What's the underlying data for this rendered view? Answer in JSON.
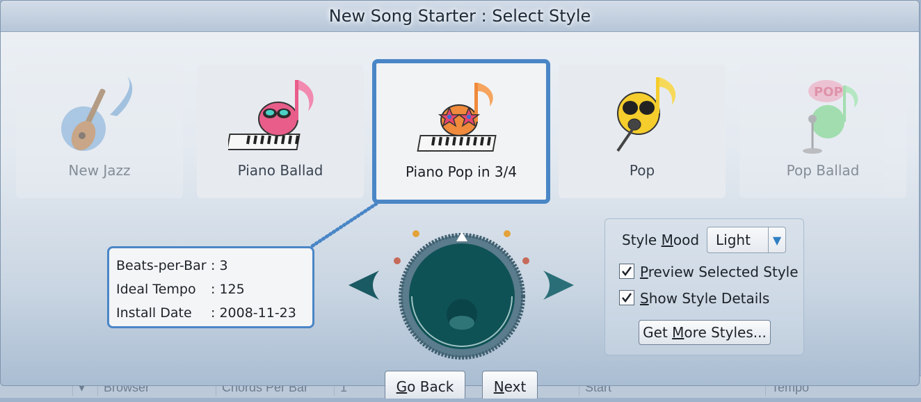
{
  "window": {
    "title": "New Song Starter : Select Style"
  },
  "styles": [
    {
      "label": "New Jazz",
      "icon": "guitar-note-icon"
    },
    {
      "label": "Piano Ballad",
      "icon": "piano-ballad-note-icon"
    },
    {
      "label": "Piano Pop in 3/4",
      "icon": "piano-pop-note-icon"
    },
    {
      "label": "Pop",
      "icon": "pop-mic-note-icon"
    },
    {
      "label": "Pop Ballad",
      "icon": "pop-ballad-note-icon"
    }
  ],
  "selected_style": "Piano Pop in 3/4",
  "details": {
    "beats_label": "Beats-per-Bar",
    "beats_value": ": 3",
    "tempo_label": "Ideal Tempo",
    "tempo_value": ": 125",
    "date_label": "Install Date",
    "date_value": ": 2008-11-23"
  },
  "options": {
    "mood_label_pre": "Style ",
    "mood_label_u": "M",
    "mood_label_post": "ood",
    "mood_value": "Light",
    "preview_u": "P",
    "preview_rest": "review Selected Style",
    "preview_checked": true,
    "details_u": "S",
    "details_rest": "how Style Details",
    "details_checked": true,
    "more_pre": "Get ",
    "more_u": "M",
    "more_post": "ore Styles..."
  },
  "nav": {
    "back_u": "G",
    "back_rest": "o Back",
    "next_u": "N",
    "next_rest": "ext"
  },
  "background_strip": [
    "Browser",
    "Chords Per Bar",
    "1",
    "Start",
    "Tempo"
  ],
  "colors": {
    "accent": "#4a86c6",
    "knob": "#0f5256",
    "knob_ring": "#4d6e80"
  }
}
